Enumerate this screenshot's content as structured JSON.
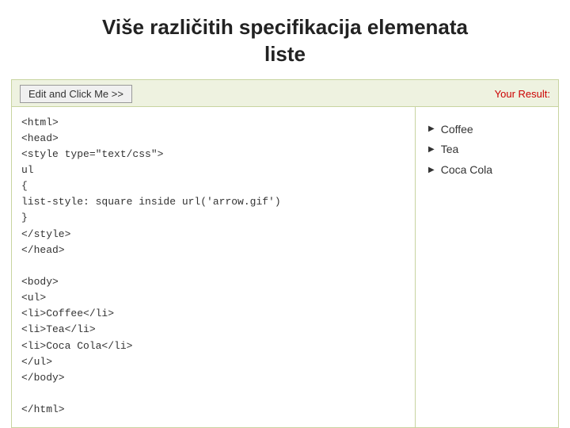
{
  "page": {
    "title_line1": "Više različitih specifikacija elemenata",
    "title_line2": "liste"
  },
  "toolbar": {
    "edit_button_label": "Edit and Click Me >>",
    "result_label": "Your Result:"
  },
  "code_editor": {
    "content": "<html>\n<head>\n<style type=\"text/css\">\nul\n{\nlist-style: square inside url('arrow.gif')\n}\n</style>\n</head>\n\n<body>\n<ul>\n<li>Coffee</li>\n<li>Tea</li>\n<li>Coca Cola</li>\n</ul>\n</body>\n\n</html>"
  },
  "result": {
    "items": [
      {
        "label": "Coffee"
      },
      {
        "label": "Tea"
      },
      {
        "label": "Coca Cola"
      }
    ]
  }
}
